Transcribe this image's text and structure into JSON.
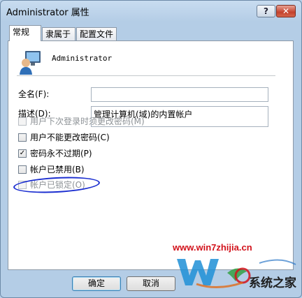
{
  "window": {
    "title": "Administrator 属性",
    "help_label": "?",
    "close_label": "✕"
  },
  "tabs": [
    {
      "label": "常规",
      "active": true
    },
    {
      "label": "隶属于",
      "active": false
    },
    {
      "label": "配置文件",
      "active": false
    }
  ],
  "user": {
    "name": "Administrator",
    "icon": "user-icon"
  },
  "fields": {
    "fullname_label": "全名(F):",
    "fullname_value": "",
    "description_label": "描述(D):",
    "description_value": "管理计算机(域)的内置帐户"
  },
  "options": [
    {
      "label": "用户下次登录时须更改密码(M)",
      "checked": false,
      "enabled": false
    },
    {
      "label": "用户不能更改密码(C)",
      "checked": false,
      "enabled": true
    },
    {
      "label": "密码永不过期(P)",
      "checked": true,
      "enabled": true
    },
    {
      "label": "帐户已禁用(B)",
      "checked": false,
      "enabled": true
    },
    {
      "label": "帐户已锁定(O)",
      "checked": false,
      "enabled": false
    }
  ],
  "buttons": {
    "ok_label": "确定",
    "cancel_label": "取消"
  },
  "watermark": {
    "url": "www.win7zhijia.cn",
    "brand": "系统之家"
  },
  "colors": {
    "annotation_circle": "#1b2ed0",
    "watermark_url": "#d2121b",
    "close_button": "#c4412c"
  }
}
